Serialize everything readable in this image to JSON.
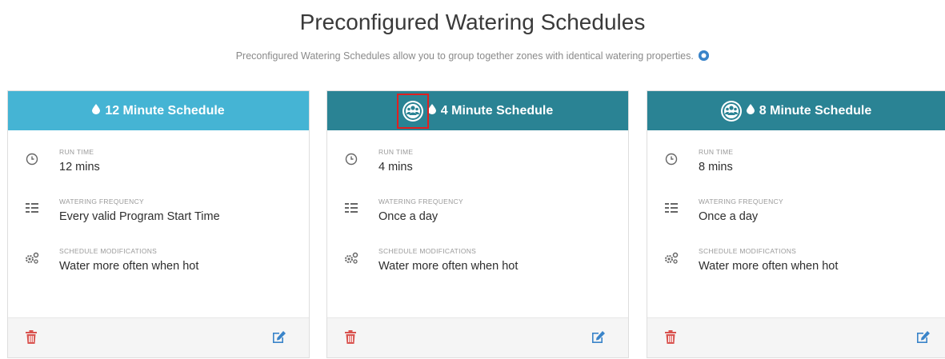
{
  "page": {
    "title": "Preconfigured Watering Schedules",
    "subtitle": "Preconfigured Watering Schedules allow you to group together zones with identical watering properties."
  },
  "colors": {
    "header_light": "#45b4d4",
    "header_dark": "#2a8394",
    "delete_red": "#d9534f",
    "edit_blue": "#3a84c9",
    "highlight_red": "#e02020"
  },
  "labels": {
    "run_time": "RUN TIME",
    "frequency": "WATERING FREQUENCY",
    "modifications": "SCHEDULE MODIFICATIONS"
  },
  "cards": [
    {
      "title": "12 Minute Schedule",
      "run_time": "12 mins",
      "frequency": "Every valid Program Start Time",
      "modifications": "Water more often when hot",
      "has_group_icon": false,
      "group_icon_highlighted": false
    },
    {
      "title": "4 Minute Schedule",
      "run_time": "4 mins",
      "frequency": "Once a day",
      "modifications": "Water more often when hot",
      "has_group_icon": true,
      "group_icon_highlighted": true
    },
    {
      "title": "8 Minute Schedule",
      "run_time": "8 mins",
      "frequency": "Once a day",
      "modifications": "Water more often when hot",
      "has_group_icon": true,
      "group_icon_highlighted": false
    }
  ],
  "icons": {
    "help": "help-circle-icon",
    "drop": "water-drop-icon",
    "group": "group-users-icon",
    "clock": "clock-icon",
    "frequency": "list-icon",
    "modifications": "gears-icon",
    "delete": "trash-icon",
    "edit": "edit-icon"
  }
}
